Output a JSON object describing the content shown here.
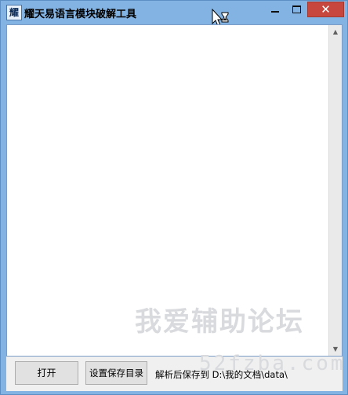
{
  "window": {
    "title": "耀天易语言模块破解工具",
    "icon_glyph": "耀",
    "controls": {
      "minimize": "",
      "maximize": "",
      "close": "✕"
    }
  },
  "toolbar": {
    "open_label": "打开",
    "set_save_dir_label": "设置保存目录",
    "save_path_text": "解析后保存到 D:\\我的文档\\data\\"
  },
  "watermark": {
    "cn": "我爱辅助论坛",
    "url": "52fzba.com"
  },
  "colors": {
    "titlebar": "#83b3e3",
    "close_button": "#c7463d",
    "panel": "#f0f0f0"
  }
}
